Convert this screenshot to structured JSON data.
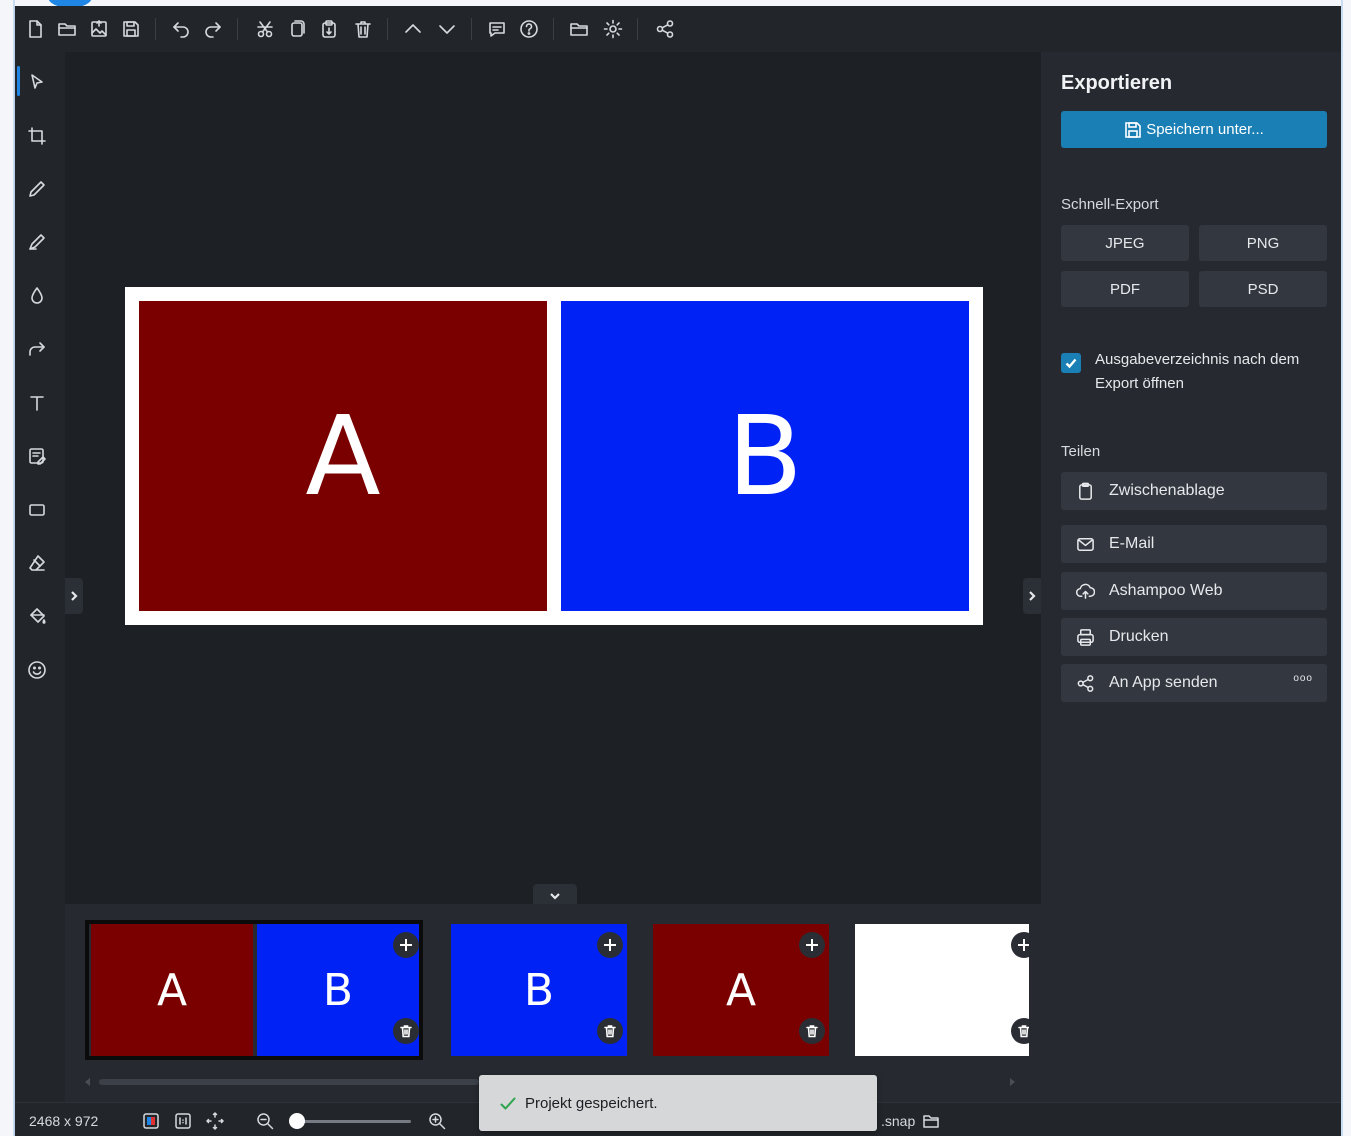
{
  "toolbar": {
    "buttons": [
      "new-file-icon",
      "open-folder-icon",
      "open-image-icon",
      "save-icon",
      "undo-icon",
      "redo-icon",
      "cut-icon",
      "copy-icon",
      "paste-icon",
      "delete-icon",
      "move-up-icon",
      "move-down-icon",
      "feedback-icon",
      "help-icon",
      "folder-icon",
      "settings-icon",
      "share-icon"
    ]
  },
  "tools": [
    "select-tool-icon",
    "crop-tool-icon",
    "pencil-tool-icon",
    "marker-tool-icon",
    "blur-tool-icon",
    "arrow-tool-icon",
    "text-tool-icon",
    "note-tool-icon",
    "rectangle-tool-icon",
    "eraser-tool-icon",
    "fill-tool-icon",
    "emoji-tool-icon"
  ],
  "canvas": {
    "panel_a_label": "A",
    "panel_b_label": "B",
    "panel_a_color": "#7a0000",
    "panel_b_color": "#0022f5"
  },
  "filmstrip": {
    "thumbs": [
      {
        "labels": [
          "A",
          "B"
        ],
        "selected": true
      },
      {
        "labels": [
          "B"
        ],
        "selected": false
      },
      {
        "labels": [
          "A"
        ],
        "selected": false
      },
      {
        "labels": [],
        "selected": false
      }
    ]
  },
  "status": {
    "dimensions": "2468 x 972",
    "filename": ".snap"
  },
  "toast": {
    "message": "Projekt gespeichert."
  },
  "panel": {
    "title": "Exportieren",
    "save_as": "Speichern unter...",
    "quick_export_title": "Schnell-Export",
    "formats": [
      "JPEG",
      "PNG",
      "PDF",
      "PSD"
    ],
    "open_dir_label": "Ausgabeverzeichnis nach dem Export öffnen",
    "open_dir_checked": true,
    "share_title": "Teilen",
    "share_items": [
      {
        "icon": "clipboard-icon",
        "label": "Zwischenablage"
      },
      {
        "icon": "mail-icon",
        "label": "E-Mail"
      },
      {
        "icon": "cloud-upload-icon",
        "label": "Ashampoo Web"
      },
      {
        "icon": "printer-icon",
        "label": "Drucken"
      },
      {
        "icon": "share-icon",
        "label": "An App senden",
        "more": "ooo"
      }
    ]
  },
  "colors": {
    "accent": "#1a7fb5",
    "background": "#1e2227"
  }
}
